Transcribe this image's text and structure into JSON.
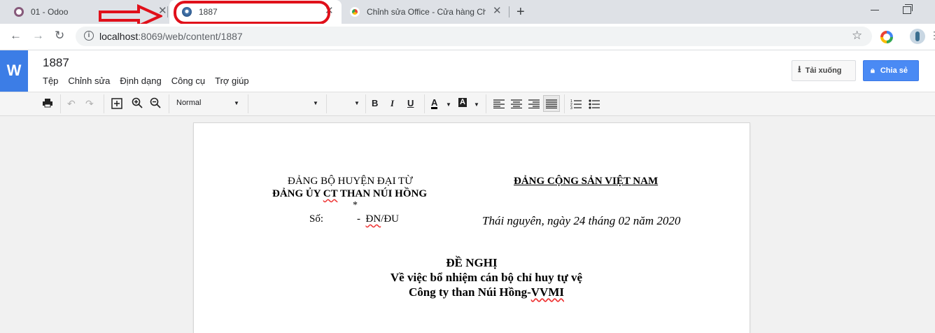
{
  "browser": {
    "tabs": [
      {
        "title": "01 - Odoo",
        "close": "✕"
      },
      {
        "title": "1887",
        "close": "✕"
      },
      {
        "title": "Chỉnh sửa Office - Cửa hàng Chrome",
        "close": "✕"
      }
    ],
    "new_tab": "+",
    "url_host": "localhost",
    "url_path": ":8069/web/content/1887"
  },
  "app": {
    "logo": "W",
    "doc_title": "1887",
    "menu": [
      "Tệp",
      "Chỉnh sửa",
      "Định dạng",
      "Công cụ",
      "Trợ giúp"
    ],
    "download_label": "Tải xuống",
    "share_label": "Chia sẻ"
  },
  "toolbar": {
    "style_value": "Normal",
    "bold": "B",
    "italic": "I",
    "underline": "U",
    "font_color": "A",
    "highlight": "A"
  },
  "document": {
    "left_header_1": "ĐẢNG BỘ HUYỆN ĐẠI TỪ",
    "left_header_2_a": "ĐẢNG ỦY ",
    "left_header_2_b": "CT",
    "left_header_2_c": " THAN NÚI HỒNG",
    "star": "*",
    "so_label": "Số:",
    "so_value_dash": "-",
    "so_value_a": "ĐN",
    "so_value_b": "/ĐU",
    "right_header": "ĐẢNG CỘNG SẢN VIỆT NAM",
    "date_line": "Thái nguyên, ngày 24 tháng 02 năm 2020",
    "title": "ĐỀ NGHỊ",
    "subtitle_1": "Về việc bổ nhiệm cán bộ chỉ huy tự vệ",
    "subtitle_2_a": "Công ty than Núi Hồng-",
    "subtitle_2_b": "VVMI"
  },
  "colors": {
    "annotation_red": "#e0101a",
    "brand_blue": "#3c7de6",
    "share_blue": "#4a8af4"
  }
}
